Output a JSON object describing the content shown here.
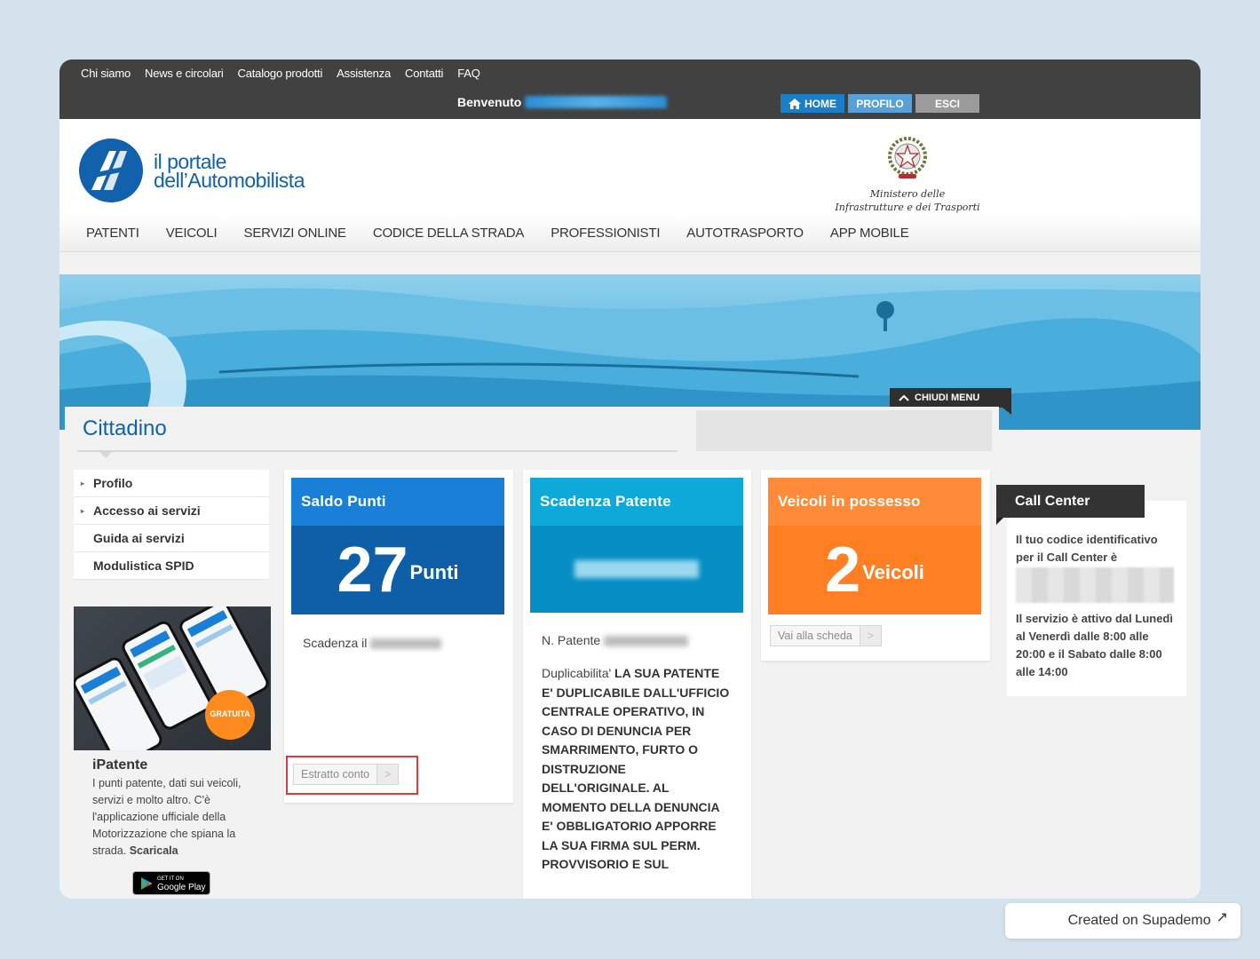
{
  "topbar": {
    "links": [
      "Chi siamo",
      "News e circolari",
      "Catalogo prodotti",
      "Assistenza",
      "Contatti",
      "FAQ"
    ],
    "welcome": "Benvenuto",
    "buttons": {
      "home": "HOME",
      "profile": "PROFILO",
      "logout": "ESCI"
    }
  },
  "header": {
    "logo_line1": "il portale",
    "logo_line2": "dell’Automobilista",
    "ministry_line1": "Ministero delle",
    "ministry_line2": "Infrastrutture e dei Trasporti"
  },
  "nav": [
    "PATENTI",
    "VEICOLI",
    "SERVIZI ONLINE",
    "CODICE DELLA STRADA",
    "PROFESSIONISTI",
    "AUTOTRASPORTO",
    "APP MOBILE"
  ],
  "banner": {
    "close_menu": "CHIUDI MENU"
  },
  "section_title": "Cittadino",
  "sidebar": {
    "items": [
      {
        "label": "Profilo",
        "caret": "▸"
      },
      {
        "label": "Accesso ai servizi",
        "caret": "▸"
      },
      {
        "label": "Guida ai servizi",
        "caret": ""
      },
      {
        "label": "Modulistica SPID",
        "caret": ""
      }
    ],
    "promo_badge": "GRATUITA",
    "promo_title": "iPatente",
    "promo_text": "I punti patente, dati sui veicoli, servizi e molto altro. C'è l'applicazione ufficiale della Motorizzazione che spiana la strada.",
    "promo_cta": "Scaricala",
    "gplay_small": "GET IT ON",
    "gplay_big": "Google Play"
  },
  "cards": {
    "saldo": {
      "title": "Saldo Punti",
      "value": "27",
      "unit": "Punti",
      "expiry_label": "Scadenza il",
      "button": "Estratto conto",
      "arrow": ">"
    },
    "scadenza": {
      "title": "Scadenza Patente",
      "npat_label": "N. Patente",
      "dup_label": "Duplicabilita'",
      "dup_text": "LA SUA PATENTE E' DUPLICABILE DALL'UFFICIO CENTRALE OPERATIVO, IN CASO DI DENUNCIA PER SMARRIMENTO, FURTO O DISTRUZIONE DELL'ORIGINALE. AL MOMENTO DELLA DENUNCIA E' OBBLIGATORIO APPORRE LA SUA FIRMA SUL PERM. PROVVISORIO E SUL"
    },
    "veicoli": {
      "title": "Veicoli in possesso",
      "value": "2",
      "unit": "Veicoli",
      "button": "Vai alla scheda",
      "arrow": ">"
    }
  },
  "call_center": {
    "title": "Call Center",
    "text1": "Il tuo codice identificativo per il Call Center è",
    "text2": "Il servizio è attivo dal Lunedì al Venerdì dalle 8:00 alle 20:00 e il Sabato dalle 8:00 alle 14:00"
  },
  "supademo": {
    "label": "Created on Supademo",
    "icon": "↗"
  },
  "colors": {
    "brand_blue": "#1261ad",
    "saldo_blue": "#1a7fd6",
    "scadenza_cyan": "#0ea9d8",
    "veicoli_orange": "#ff8b3a",
    "highlight_red": "#e03a3a"
  }
}
